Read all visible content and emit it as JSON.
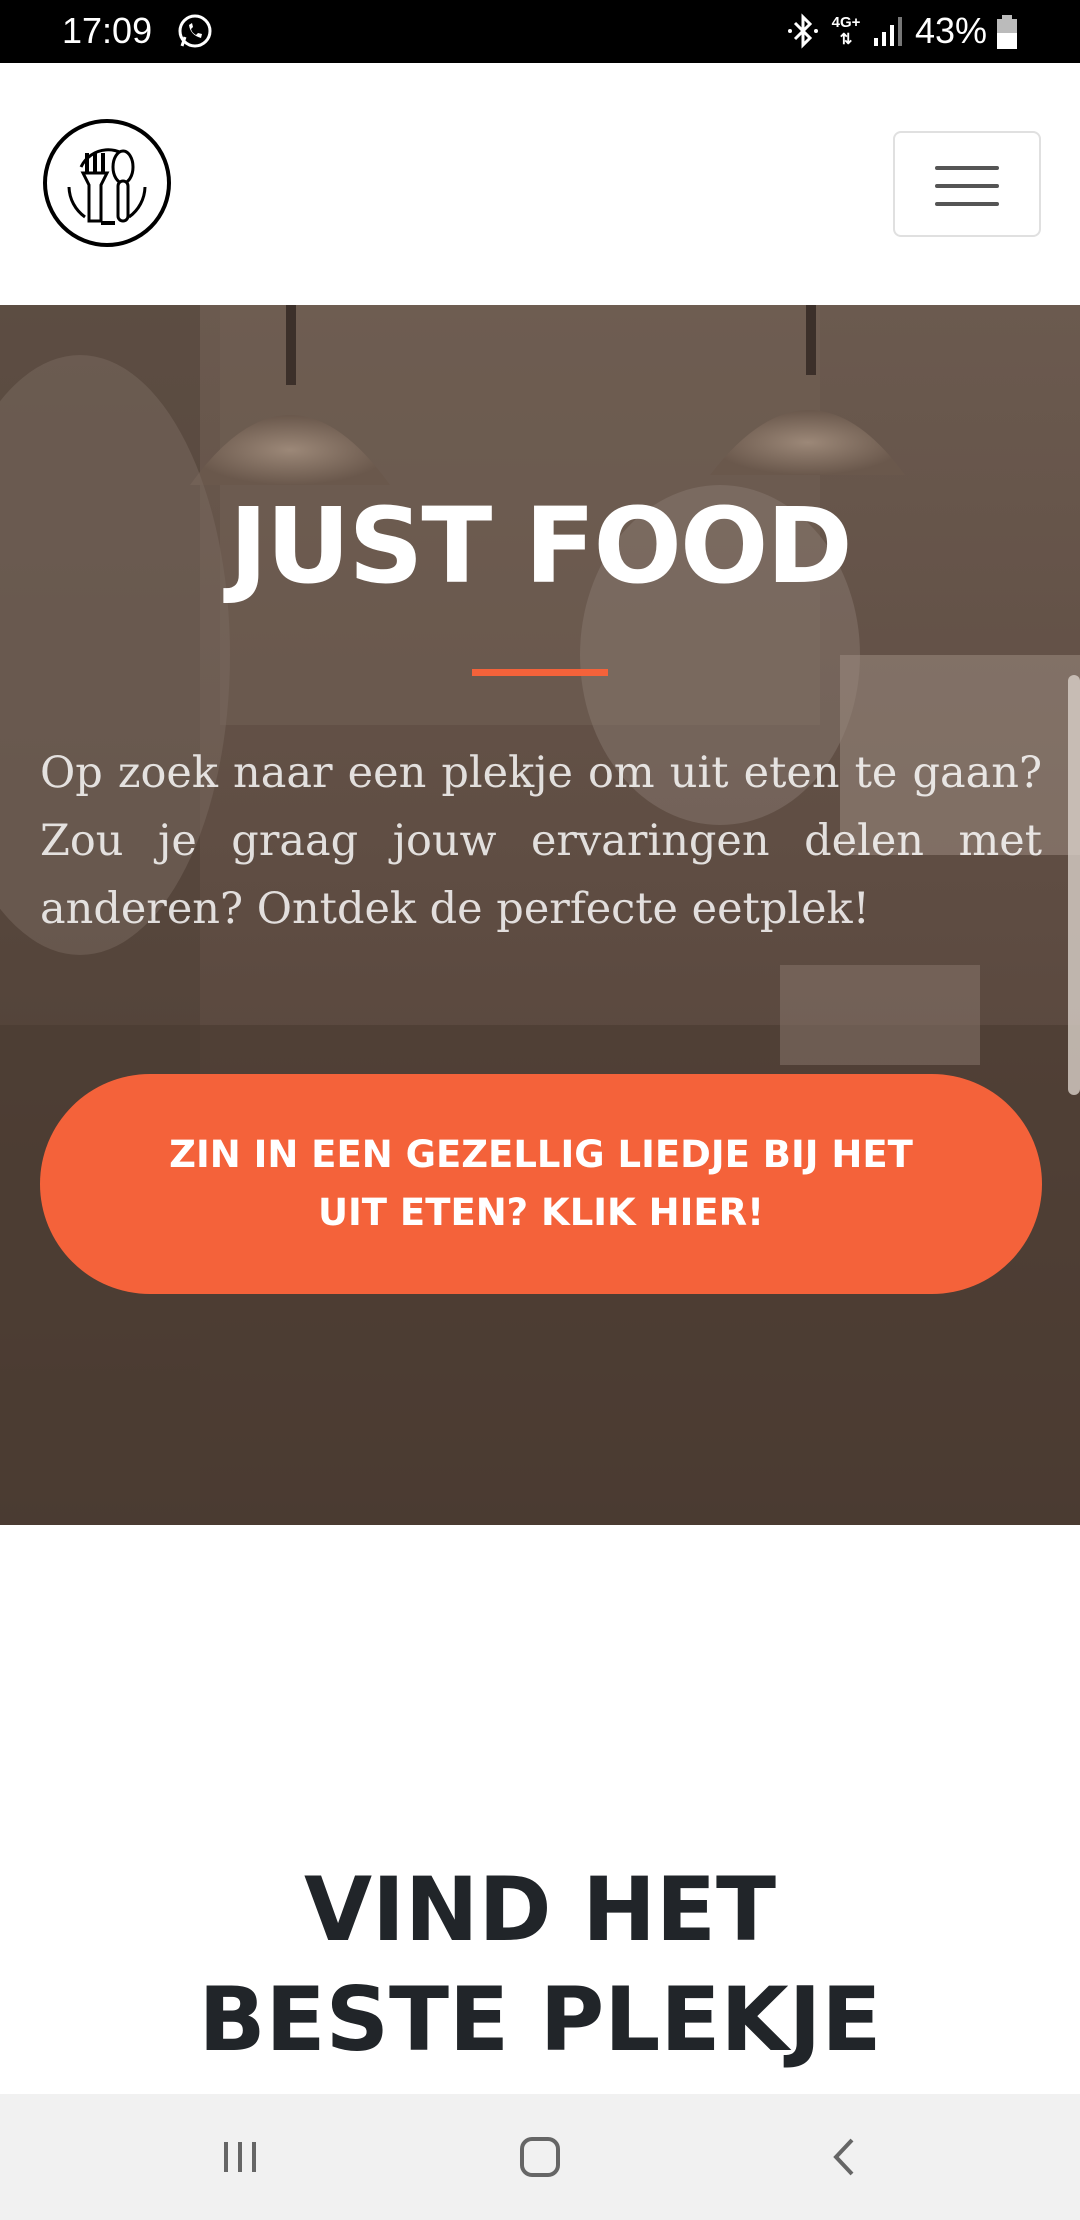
{
  "status_bar": {
    "time": "17:09",
    "network": "4G+",
    "battery": "43%",
    "icons": [
      "whatsapp-icon",
      "bluetooth-icon",
      "signal-icon",
      "battery-icon"
    ]
  },
  "header": {
    "logo_icon": "fork-spoon-icon",
    "menu_icon": "hamburger-icon"
  },
  "hero": {
    "title": "JUST FOOD",
    "text": "Op zoek naar een plekje om uit eten te gaan? Zou je graag jouw ervaringen delen met anderen? Ontdek de perfecte eetplek!",
    "cta_label": "ZIN IN EEN GEZELLIG LIEDJE BIJ HET UIT ETEN? KLIK HIER!",
    "accent_color": "#f4623a"
  },
  "section": {
    "title": "VIND HET BESTE PLEKJE"
  },
  "system_nav": {
    "icons": [
      "recent-apps-icon",
      "home-icon",
      "back-icon"
    ]
  }
}
